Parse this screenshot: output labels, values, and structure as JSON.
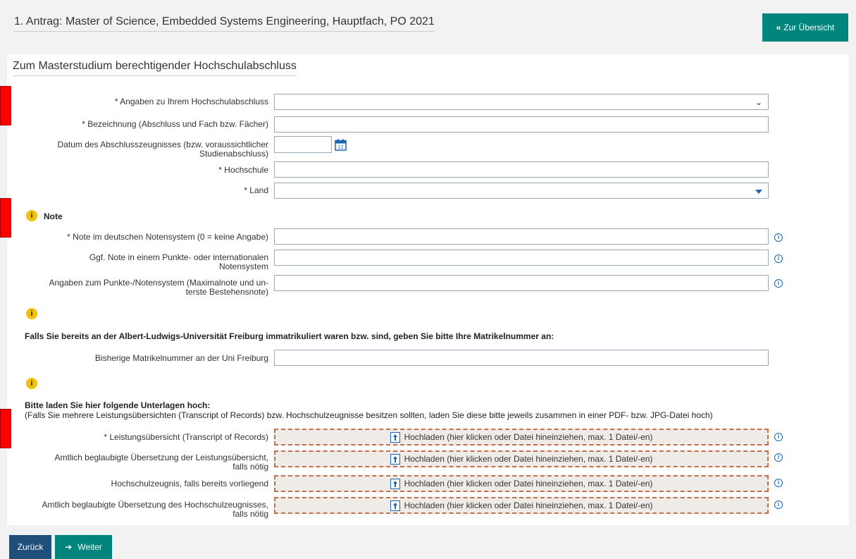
{
  "header": {
    "title": "1. Antrag: Master of Science, Embedded Systems Engineering, Hauptfach, PO 2021",
    "overview_button": "Zur Übersicht"
  },
  "section": {
    "title": "Zum Masterstudium berechtigender Hochschulabschluss"
  },
  "degree": {
    "info_label": "* Angaben zu Ihrem Hochschulabschluss",
    "info_value": "",
    "designation_label": "* Bezeichnung (Abschluss und Fach bzw. Fächer)",
    "designation_value": "",
    "date_label_line1": "Datum des Abschlusszeugnisses (bzw. voraussichtlicher",
    "date_label_line2": "Studienabschluss)",
    "date_value": "",
    "calendar_day": "12",
    "university_label": "* Hochschule",
    "university_value": "",
    "country_label": "* Land",
    "country_value": ""
  },
  "grade": {
    "heading": "Note",
    "german_label": "* Note im deutschen Notensystem (0 = keine Angabe)",
    "german_value": "",
    "intl_label_line1": "Ggf. Note in einem Punkte- oder internationalen",
    "intl_label_line2": "Notensystem",
    "intl_value": "",
    "scale_label_line1": "Angaben zum Punkte-/Notensystem (Maximalnote und un-",
    "scale_label_line2": "terste Bestehensnote)",
    "scale_value": ""
  },
  "matriculation": {
    "notice": "Falls Sie bereits an der Albert-Ludwigs-Universität Freiburg immatrikuliert waren bzw. sind, geben Sie bitte Ihre Matrikelnummer an:",
    "label": "Bisherige Matrikelnummer an der Uni Freiburg",
    "value": ""
  },
  "uploads": {
    "heading": "Bitte laden Sie hier folgende Unterlagen hoch:",
    "note": "(Falls Sie mehrere Leistungsübersichten (Transcript of Records) bzw. Hochschulzeugnisse besitzen sollten, laden Sie diese bitte jeweils zusammen in einer PDF- bzw. JPG-Datei hoch)",
    "items": [
      {
        "label_line1": "* Leistungsübersicht (Transcript of Records)",
        "label_line2": "",
        "button": "Hochladen (hier klicken oder Datei hineinziehen, max. 1 Datei/-en)"
      },
      {
        "label_line1": "Amtlich beglaubigte Übersetzung der Leistungsübersicht,",
        "label_line2": "falls nötig",
        "button": "Hochladen (hier klicken oder Datei hineinziehen, max. 1 Datei/-en)"
      },
      {
        "label_line1": "Hochschulzeugnis, falls bereits vorliegend",
        "label_line2": "",
        "button": "Hochladen (hier klicken oder Datei hineinziehen, max. 1 Datei/-en)"
      },
      {
        "label_line1": "Amtlich beglaubigte Übersetzung des Hochschulzeugnisses,",
        "label_line2": "falls nötig",
        "button": "Hochladen (hier klicken oder Datei hineinziehen, max. 1 Datei/-en)"
      }
    ]
  },
  "footer": {
    "back_button": "Zurück",
    "next_button": "Weiter"
  },
  "colors": {
    "accent_teal": "#00857c",
    "nav_blue": "#1f4f7a",
    "marker_red": "#ff0000",
    "info_yellow": "#f2c200"
  }
}
